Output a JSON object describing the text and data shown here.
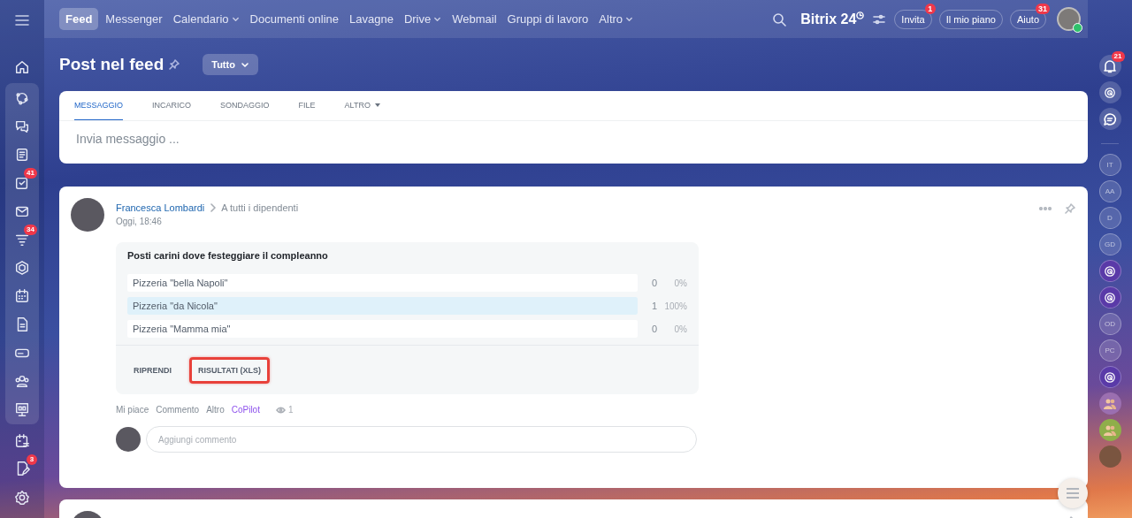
{
  "top_nav": {
    "items": [
      {
        "label": "Feed",
        "selected": true,
        "has_menu": false
      },
      {
        "label": "Messenger",
        "selected": false,
        "has_menu": false
      },
      {
        "label": "Calendario",
        "selected": false,
        "has_menu": true
      },
      {
        "label": "Documenti online",
        "selected": false,
        "has_menu": false
      },
      {
        "label": "Lavagne",
        "selected": false,
        "has_menu": false
      },
      {
        "label": "Drive",
        "selected": false,
        "has_menu": true
      },
      {
        "label": "Webmail",
        "selected": false,
        "has_menu": false
      },
      {
        "label": "Gruppi di lavoro",
        "selected": false,
        "has_menu": false
      },
      {
        "label": "Altro",
        "selected": false,
        "has_menu": true
      }
    ],
    "logo": "Bitrix 24",
    "buttons": [
      {
        "label": "Invita",
        "badge": "1"
      },
      {
        "label": "Il mio piano"
      },
      {
        "label": "Aiuto",
        "badge": "31"
      }
    ]
  },
  "left_sidebar": {
    "items": [
      {
        "grouped": false
      },
      {
        "grouped": true
      },
      {
        "grouped": true
      },
      {
        "grouped": true
      },
      {
        "badge": "41",
        "grouped": true
      },
      {
        "grouped": true
      },
      {
        "badge": "34",
        "grouped": true
      },
      {
        "grouped": true
      },
      {
        "grouped": true
      },
      {
        "grouped": true
      },
      {
        "grouped": true
      },
      {
        "grouped": true
      },
      {
        "grouped": true
      },
      {
        "grouped": false
      },
      {
        "badge": "3",
        "grouped": false
      },
      {
        "grouped": false
      }
    ]
  },
  "page": {
    "title": "Post nel feed",
    "filter": "Tutto"
  },
  "composer": {
    "tabs": [
      {
        "label": "MESSAGGIO",
        "selected": true,
        "has_menu": false
      },
      {
        "label": "INCARICO",
        "selected": false,
        "has_menu": false
      },
      {
        "label": "SONDAGGIO",
        "selected": false,
        "has_menu": false
      },
      {
        "label": "FILE",
        "selected": false,
        "has_menu": false
      },
      {
        "label": "ALTRO",
        "selected": false,
        "has_menu": true
      }
    ],
    "placeholder": "Invia messaggio ..."
  },
  "post": {
    "author": "Francesca Lombardi",
    "recipients": "A tutti i dipendenti",
    "time": "Oggi, 18:46",
    "poll": {
      "question": "Posti carini dove festeggiare il compleanno",
      "options": [
        {
          "label": "Pizzeria \"bella Napoli\"",
          "level": 0,
          "votes": "0",
          "percent": "0%"
        },
        {
          "label": "Pizzeria \"da Nicola\"",
          "level": 1,
          "votes": "1",
          "percent": "100%"
        },
        {
          "label": "Pizzeria \"Mamma mia\"",
          "level": 0,
          "votes": "0",
          "percent": "0%"
        }
      ],
      "actions": [
        {
          "label": "RIPRENDI",
          "highlighted": false
        },
        {
          "label": "RISULTATI (XLS)",
          "highlighted": true
        }
      ]
    },
    "footer": [
      {
        "label": "Mi piace",
        "kind": "plain"
      },
      {
        "label": "Commento",
        "kind": "plain"
      },
      {
        "label": "Altro",
        "kind": "plain"
      },
      {
        "label": "CoPilot",
        "kind": "copilot"
      }
    ],
    "views": "1",
    "comment_placeholder": "Aggiungi commento"
  },
  "right_rail": {
    "items": [
      {
        "kind": "bell",
        "badge": "21"
      },
      {
        "kind": "logo"
      },
      {
        "kind": "chat"
      },
      {
        "kind": "initials",
        "text": "IT"
      },
      {
        "kind": "initials",
        "text": "AA"
      },
      {
        "kind": "initials",
        "text": "D"
      },
      {
        "kind": "initials",
        "text": "GD"
      },
      {
        "kind": "logo"
      },
      {
        "kind": "logo"
      },
      {
        "kind": "initials",
        "text": "OD"
      },
      {
        "kind": "initials",
        "text": "PC"
      },
      {
        "kind": "logo"
      },
      {
        "kind": "group",
        "color": "#9b6fb0"
      },
      {
        "kind": "group",
        "color": "#8fae4a"
      },
      {
        "kind": "photo"
      }
    ]
  }
}
